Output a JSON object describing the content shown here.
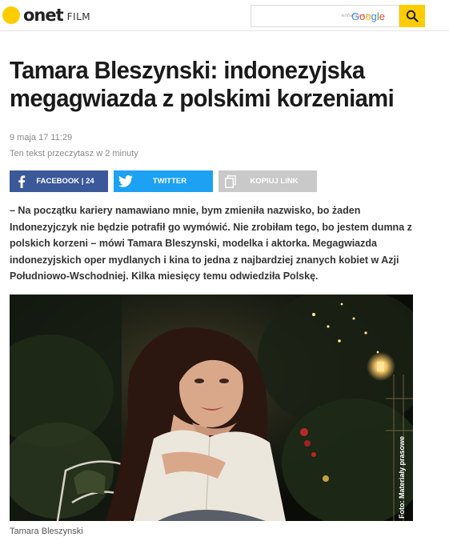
{
  "header": {
    "logo_text": "onet",
    "section": "FILM",
    "search_placeholder": "enhanced by",
    "search_brand": "Google"
  },
  "article": {
    "title": "Tamara Bleszynski: indonezyjska megagwiazda z polskimi korzeniami",
    "date": "9 maja 17 11:29",
    "read_time": "Ten tekst przeczytasz w 2 minuty",
    "lead": "– Na początku kariery namawiano mnie, bym zmieniła nazwisko, bo żaden Indonezyjczyk nie będzie potrafił go wymówić. Nie zrobiłam tego, bo jestem dumna z polskich korzeni – mówi Tamara Bleszynski, modelka i aktorka. Megagwiazda indonezyjskich oper mydlanych i kina to jedna z najbardziej znanych kobiet w Azji Południowo-Wschodniej. Kilka miesięcy temu odwiedziła Polskę.",
    "photo_credit": "Foto: Materiały prasowe",
    "photo_caption": "Tamara Bleszynski"
  },
  "share": {
    "facebook_label": "FACEBOOK | 24",
    "twitter_label": "TWITTER",
    "copy_label": "KOPIUJ LINK"
  },
  "colors": {
    "brand_yellow": "#ffcc00",
    "facebook": "#3b5998",
    "twitter": "#1da1f2",
    "copy": "#c9c9c9"
  },
  "icons": {
    "logo": "onet-dot-logo",
    "search": "search-icon",
    "facebook": "facebook-icon",
    "twitter": "twitter-icon",
    "copy": "copy-link-icon"
  }
}
